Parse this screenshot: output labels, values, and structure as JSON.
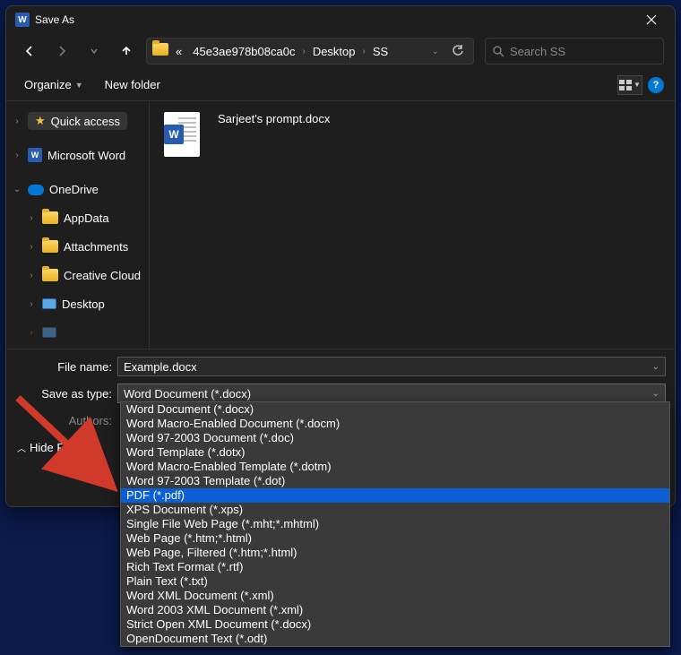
{
  "window": {
    "title": "Save As"
  },
  "breadcrumbs": {
    "b0": "«",
    "b1": "45e3ae978b08ca0c",
    "b2": "Desktop",
    "b3": "SS"
  },
  "search": {
    "placeholder": "Search SS"
  },
  "toolbar": {
    "organize": "Organize",
    "newfolder": "New folder"
  },
  "sidebar": {
    "quick": "Quick access",
    "word": "Microsoft Word",
    "onedrive": "OneDrive",
    "appdata": "AppData",
    "attachments": "Attachments",
    "creative": "Creative Cloud",
    "desktop": "Desktop"
  },
  "file": {
    "name": "Sarjeet's prompt.docx"
  },
  "fields": {
    "filename_label": "File name:",
    "filename_value": "Example.docx",
    "savetype_label": "Save as type:",
    "savetype_value": "Word Document (*.docx)",
    "authors_label": "Authors:"
  },
  "hidefolders": "Hide Folders",
  "dropdown": {
    "items": [
      "Word Document (*.docx)",
      "Word Macro-Enabled Document (*.docm)",
      "Word 97-2003 Document (*.doc)",
      "Word Template (*.dotx)",
      "Word Macro-Enabled Template (*.dotm)",
      "Word 97-2003 Template (*.dot)",
      "PDF (*.pdf)",
      "XPS Document (*.xps)",
      "Single File Web Page (*.mht;*.mhtml)",
      "Web Page (*.htm;*.html)",
      "Web Page, Filtered (*.htm;*.html)",
      "Rich Text Format (*.rtf)",
      "Plain Text (*.txt)",
      "Word XML Document (*.xml)",
      "Word 2003 XML Document (*.xml)",
      "Strict Open XML Document (*.docx)",
      "OpenDocument Text (*.odt)"
    ],
    "selected_index": 6
  }
}
